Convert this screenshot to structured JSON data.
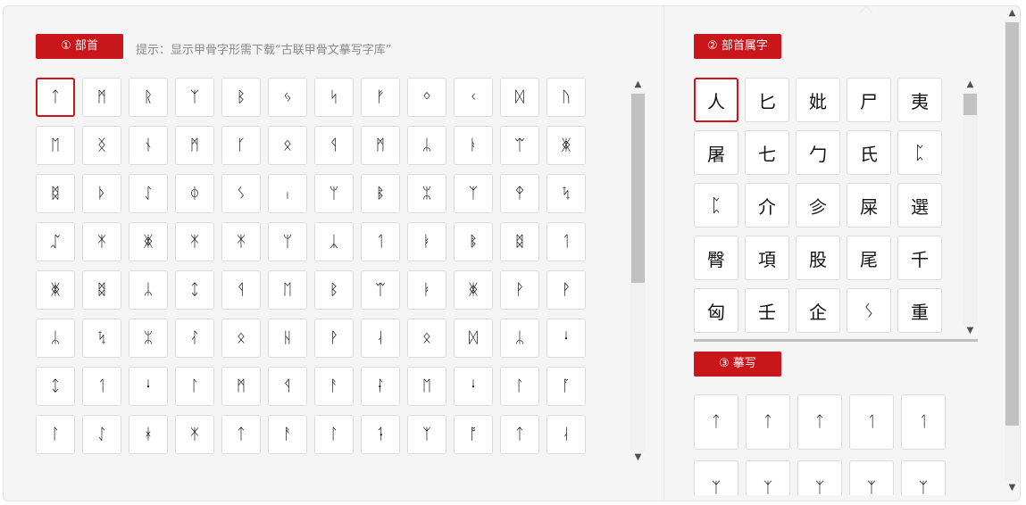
{
  "radicals": {
    "label": "① 部首",
    "hint": "提示：显示甲骨字形需下载“古联甲骨文摹写字库”",
    "selected_index": 0,
    "glyphs": [
      "ᛏ",
      "ᛗ",
      "ᚱ",
      "ᛉ",
      "ᛒ",
      "ᛃ",
      "ᛋ",
      "ᚠ",
      "ᛜ",
      "ᚲ",
      "ᛞ",
      "ᚢ",
      "ᛖ",
      "ᛝ",
      "ᚾ",
      "ᛗ",
      "ᚴ",
      "ᛟ",
      "ᛩ",
      "ᛗ",
      "ᛦ",
      "ᚭ",
      "ᛠ",
      "ᛤ",
      "ᛥ",
      "ᚦ",
      "ᛇ",
      "ᛰ",
      "ᛊ",
      "ᛧ",
      "ᛘ",
      "ᛔ",
      "ᛯ",
      "ᛉ",
      "ᛳ",
      "ᛪ",
      "ᛢ",
      "ᛡ",
      "ᛤ",
      "ᛡ",
      "ᛡ",
      "ᛘ",
      "ᛣ",
      "ᛐ",
      "ᛓ",
      "ᛔ",
      "ᛥ",
      "ᛐ",
      "ᛤ",
      "ᛥ",
      "ᛦ",
      "ᛨ",
      "ᛩ",
      "ᛖ",
      "ᛒ",
      "ᛠ",
      "ᛓ",
      "ᛤ",
      "ᚹ",
      "ᚹ",
      "ᛦ",
      "ᛪ",
      "ᛯ",
      "ᛮ",
      "ᛟ",
      "ᚺ",
      "ᚹ",
      "ᛆ",
      "ᛟ",
      "ᛞ",
      "ᛦ",
      "ᛍ",
      "ᛨ",
      "ᛐ",
      "ᛍ",
      "ᛚ",
      "ᛗ",
      "ᛩ",
      "ᚨ",
      "ᛛ",
      "ᛖ",
      "ᛍ",
      "ᛚ",
      "ᚪ",
      "ᛚ",
      "ᛇ",
      "ᚼ",
      "ᛡ",
      "ᛏ",
      "ᚨ",
      "ᛚ",
      "ᛑ",
      "ᛉ",
      "ᚩ",
      "ᛏ",
      "ᛆ"
    ]
  },
  "radical_chars": {
    "label": "② 部首属字",
    "selected_index": 0,
    "chars": [
      "人",
      "匕",
      "妣",
      "尸",
      "夷",
      "屠",
      "七",
      "勹",
      "氏",
      "ᛈ",
      "ᛈ",
      "介",
      "㐱",
      "屎",
      "選",
      "臀",
      "項",
      "股",
      "尾",
      "千",
      "匈",
      "壬",
      "企",
      "ᛊ",
      "重"
    ]
  },
  "tracing": {
    "label": "③ 摹写",
    "glyphs": [
      "ᛏ",
      "ᛏ",
      "ᛏ",
      "ᛐ",
      "ᛐ",
      "ᛉ",
      "ᛉ",
      "ᛉ",
      "ᛉ",
      "ᛉ"
    ]
  }
}
